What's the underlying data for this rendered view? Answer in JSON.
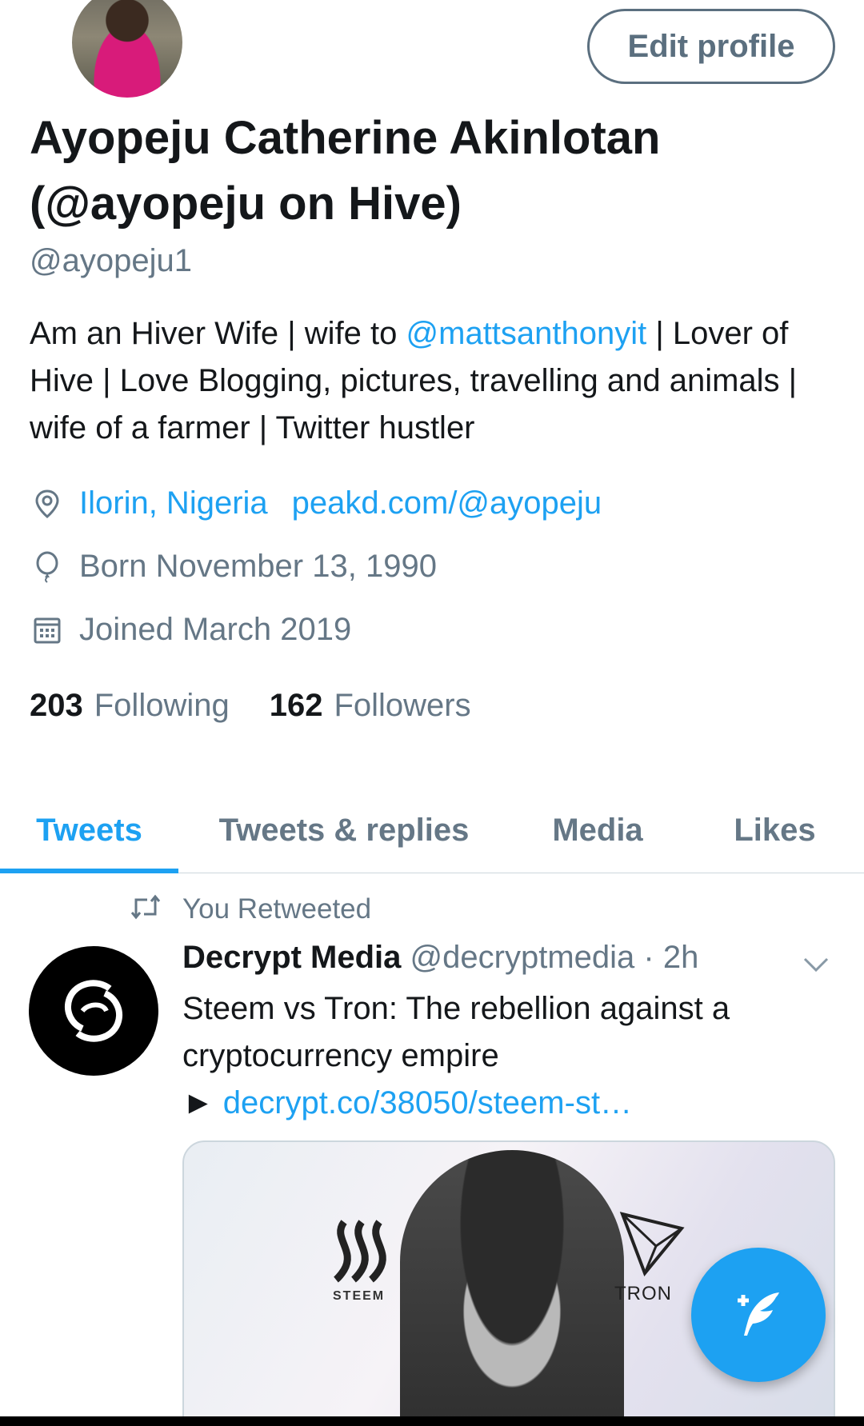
{
  "profile": {
    "edit_label": "Edit profile",
    "name_line1": "Ayopeju Catherine Akinlotan",
    "name_line2": "(@ayopeju on Hive)",
    "handle": "@ayopeju1",
    "bio": {
      "part1": "Am an Hiver Wife  | wife to ",
      "mention": "@mattsanthonyit",
      "part2": " | Lover of Hive | Love Blogging, pictures, travelling and animals | wife of a farmer | Twitter hustler"
    },
    "location": "Ilorin, Nigeria",
    "website": "peakd.com/@ayopeju",
    "born": "Born November 13, 1990",
    "joined": "Joined March 2019",
    "following_count": "203",
    "following_label": "Following",
    "followers_count": "162",
    "followers_label": "Followers"
  },
  "tabs": [
    {
      "label": "Tweets",
      "active": true
    },
    {
      "label": "Tweets & replies",
      "active": false
    },
    {
      "label": "Media",
      "active": false
    },
    {
      "label": "Likes",
      "active": false
    }
  ],
  "tweet": {
    "retweet_label": "You Retweeted",
    "author": "Decrypt Media",
    "handle_time": "@decryptmedia · 2h",
    "text": "Steem vs Tron: The rebellion against a cryptocurrency empire",
    "link_prefix": "► ",
    "link": "decrypt.co/38050/steem-st…",
    "media": {
      "steem_label": "STEEM",
      "tron_label": "TRON"
    }
  },
  "icons": {
    "location": "location-pin-icon",
    "born": "balloon-icon",
    "joined": "calendar-icon",
    "retweet": "retweet-icon",
    "caret": "chevron-down-icon",
    "compose": "compose-tweet-icon"
  },
  "colors": {
    "accent": "#1da1f2",
    "secondary_text": "#657786",
    "primary_text": "#14171a"
  }
}
